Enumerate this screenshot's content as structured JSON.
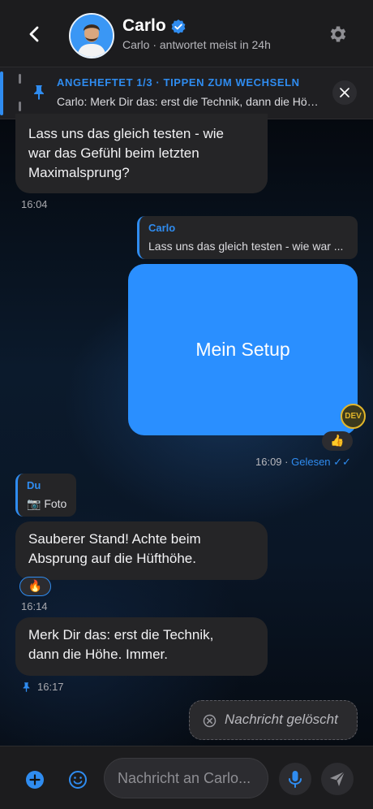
{
  "header": {
    "title": "Carlo",
    "subtitle": "Carlo · antwortet meist in 24h",
    "verified": true
  },
  "pinned": {
    "title": "ANGEHEFTET 1/3 · TIPPEN ZUM WECHSELN",
    "text": "Carlo: Merk Dir das: erst die Technik, dann die Höhe. Immer."
  },
  "messages": {
    "m1": {
      "line1": "Lass uns das gleich testen - wie",
      "line2": "war das Gefühl beim letzten",
      "line3": "Maximalsprung?",
      "time": "16:04"
    },
    "m2": {
      "reply_name": "Carlo",
      "reply_text": "Lass uns das gleich testen - wie war ...",
      "media_label": "Mein Setup",
      "badge": "DEV",
      "reaction": "👍",
      "time": "16:09 ·",
      "status": "Gelesen ✓✓"
    },
    "m3": {
      "reply_name": "Du",
      "reply_text": "📷 Foto",
      "line1": "Sauberer Stand! Achte beim",
      "line2": "Absprung auf die Hüfthöhe.",
      "reaction": "🔥",
      "time": "16:14"
    },
    "m4": {
      "line1": "Merk Dir das: erst die Technik,",
      "line2": "dann die Höhe. Immer.",
      "time": "16:17"
    },
    "deleted": "Nachricht gelöscht"
  },
  "composer": {
    "placeholder": "Nachricht an Carlo..."
  },
  "colors": {
    "accent": "#2f8cf0",
    "bubble_in": "#252527",
    "header_bg": "#1c1c1e"
  }
}
